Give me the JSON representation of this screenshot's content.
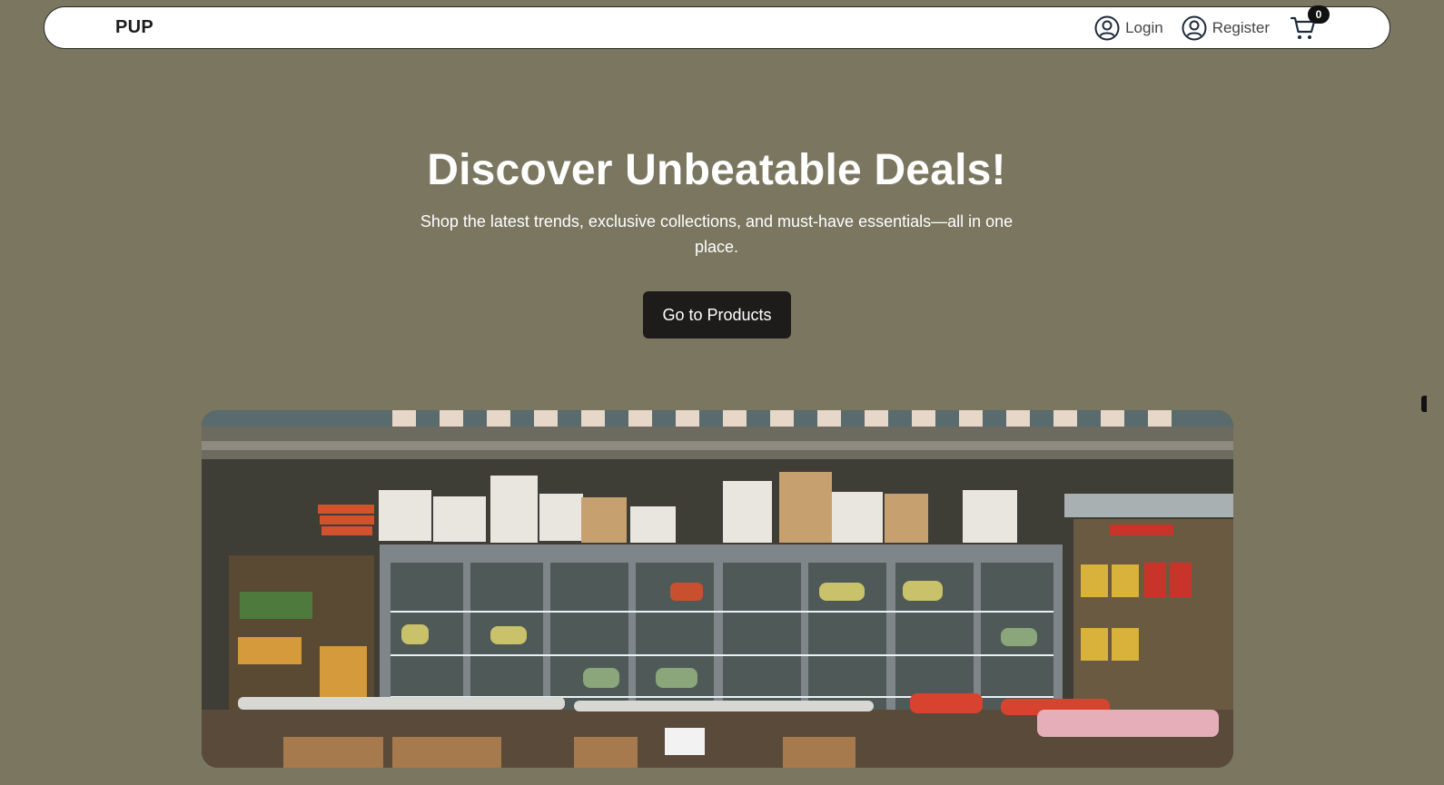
{
  "navbar": {
    "brand": "PUP",
    "login_label": "Login",
    "register_label": "Register",
    "cart_count": "0"
  },
  "hero": {
    "title": "Discover Unbeatable Deals!",
    "subtitle": "Shop the latest trends, exclusive collections, and must-have essentials—all in one place.",
    "cta_label": "Go to Products"
  },
  "icons": {
    "login": "user-circle-icon",
    "register": "user-circle-icon",
    "cart": "shopping-cart-icon"
  },
  "colors": {
    "background": "#7a7660",
    "navbar_bg": "#ffffff",
    "button_bg": "#1e1b1b",
    "text_light": "#ffffff"
  }
}
